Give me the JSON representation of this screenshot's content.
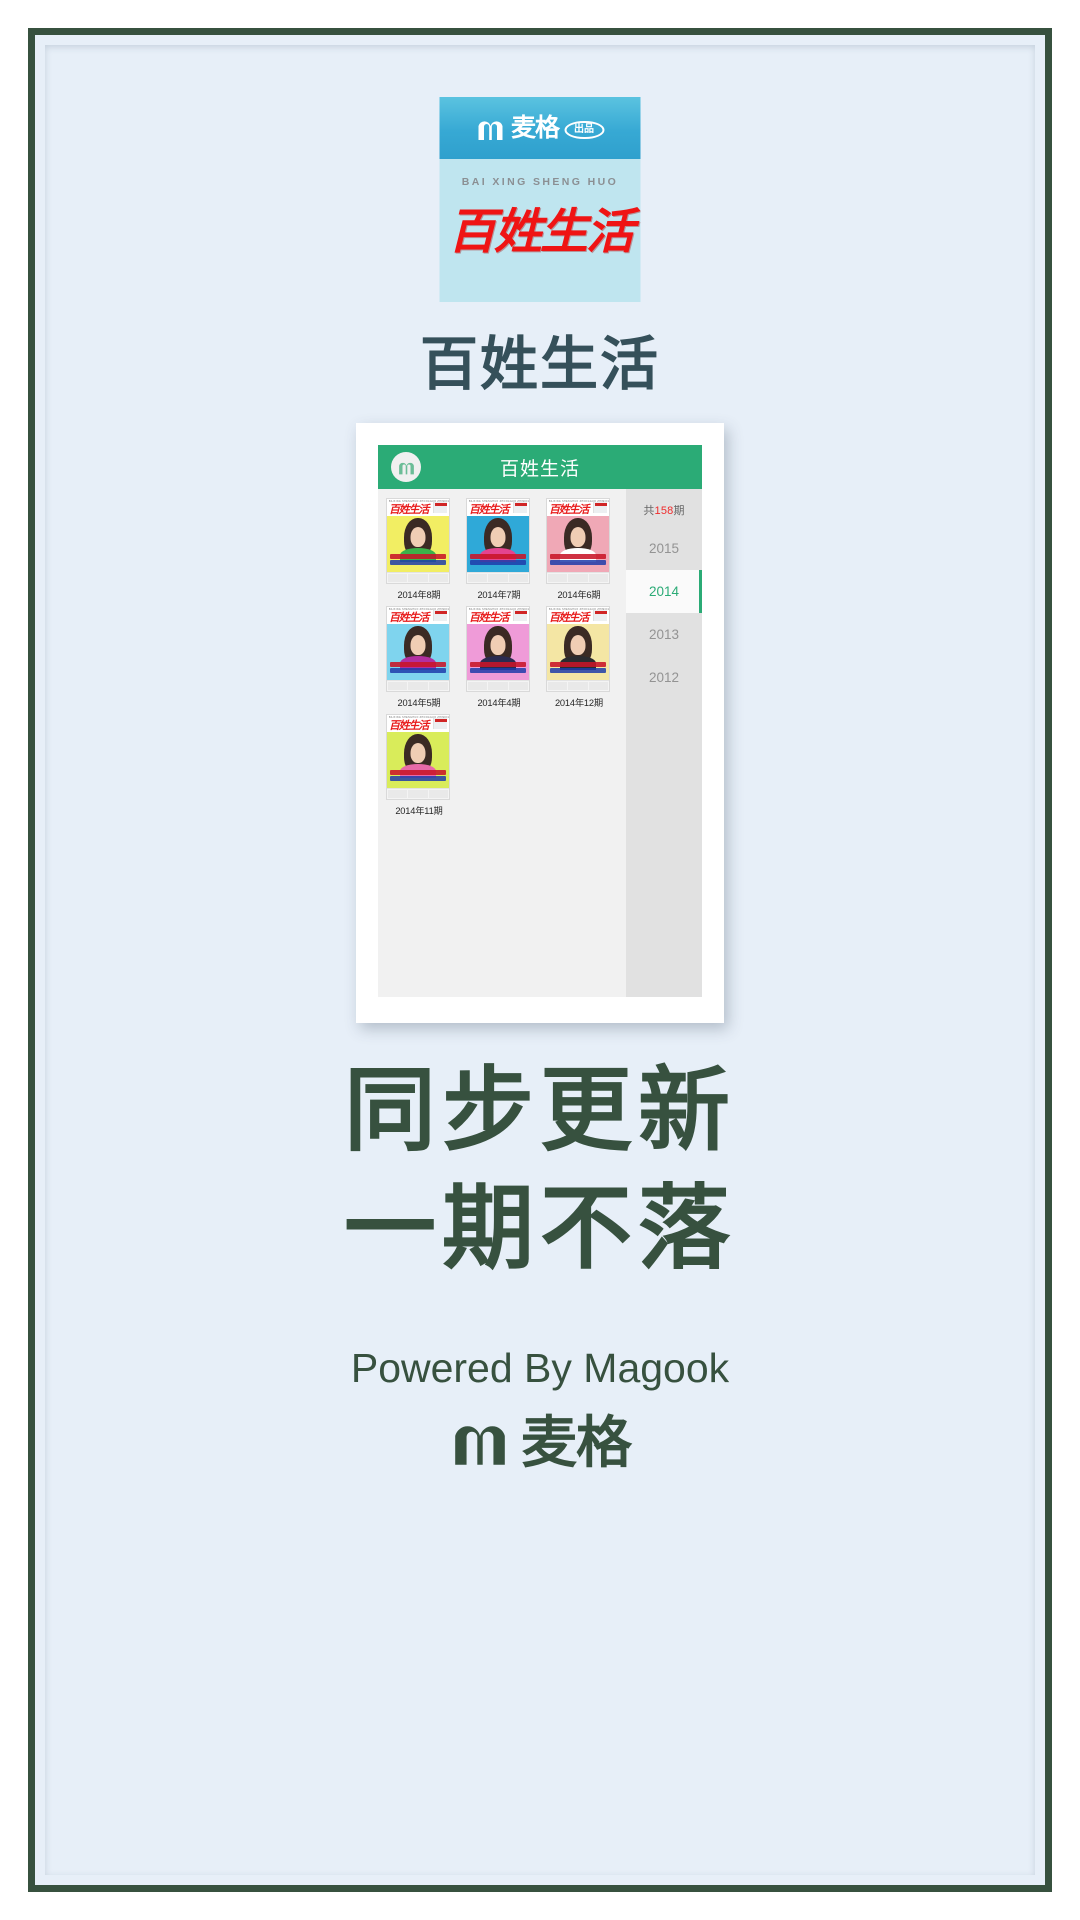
{
  "poster": {
    "background_color": "#e7eff8",
    "border_color": "#37513f",
    "accent_green": "#2bab76",
    "text_dark": "#37513f",
    "logo_red": "#ef1414"
  },
  "app_icon": {
    "band_brand_text": "麦格",
    "band_badge_text": "出品",
    "pinyin": "BAI XING SHENG HUO",
    "cn_title": "百姓生活",
    "m_icon": "magook-m-icon"
  },
  "app_name": "百姓生活",
  "screenshot": {
    "header": {
      "logo_icon": "magook-m-circle-icon",
      "title": "百姓生活"
    },
    "issues": [
      {
        "label": "2014年8期",
        "bg": "#f2ee63",
        "outfit": "#3bb24a",
        "py": "BAIXING  SHENGHUO  ZHONGGUO ZHIMING  KANWU",
        "h1": "别让一份心意让",
        "h2": "不是期待你 明天做"
      },
      {
        "label": "2014年7期",
        "bg": "#2fa9d8",
        "outfit": "#e4448f",
        "py": "BAIXING  SHENGHUO  ZHONGGUO ZHIMING  KANWU",
        "h1": "女喜欢\"生活过日子\"",
        "h2": "是成长是 追着 包补情"
      },
      {
        "label": "2014年6期",
        "bg": "#f0a8b6",
        "outfit": "#ffffff",
        "py": "BAIXING  SHENGHUO  ZHONGGUO ZHIMING  KANWU",
        "h1": "\"寒冷\" 卫生和理肝",
        "h2": "12个智慧 \"孩子\""
      },
      {
        "label": "2014年5期",
        "bg": "#7fd4ee",
        "outfit": "#b22fa0",
        "py": "BAIXING  SHENGHUO  ZHONGGUO ZHIMING  KANWU",
        "h1": "\"最美乡村妹妹\"",
        "h2": "13年守护植物闺蜜"
      },
      {
        "label": "2014年4期",
        "bg": "#ef9bd8",
        "outfit": "#2b2b50",
        "py": "BAIXING  SHENGHUO  ZHONGGUO ZHIMING  KANWU",
        "h1": "那比 \"留守儿童\"",
        "h2": "爱是 \"爱老爱少\""
      },
      {
        "label": "2014年12期",
        "bg": "#f4e6a4",
        "outfit": "#2b2b30",
        "py": "BAIXING  SHENGHUO  ZHONGGUO ZHIMING  KANWU",
        "h1": "五眼见 留守等等",
        "h2": "爱妈妈要和她的母与孩孩"
      },
      {
        "label": "2014年11期",
        "bg": "#d9ec5a",
        "outfit": "#e86aa8",
        "py": "BAIXING  SHENGHUO  ZHONGGUO ZHIMING  KANWU",
        "h1": "长嫂如母 嫂子",
        "h2": "姐姐智障小叔子60年"
      }
    ],
    "sidebar": {
      "total_prefix": "共",
      "total_count": "158",
      "total_suffix": "期",
      "years": [
        {
          "label": "2015",
          "active": false
        },
        {
          "label": "2014",
          "active": true
        },
        {
          "label": "2013",
          "active": false
        },
        {
          "label": "2012",
          "active": false
        }
      ]
    }
  },
  "tagline_line1": "同步更新",
  "tagline_line2": "一期不落",
  "powered_by": "Powered By Magook",
  "brand": {
    "icon": "magook-m-icon",
    "text": "麦格"
  }
}
